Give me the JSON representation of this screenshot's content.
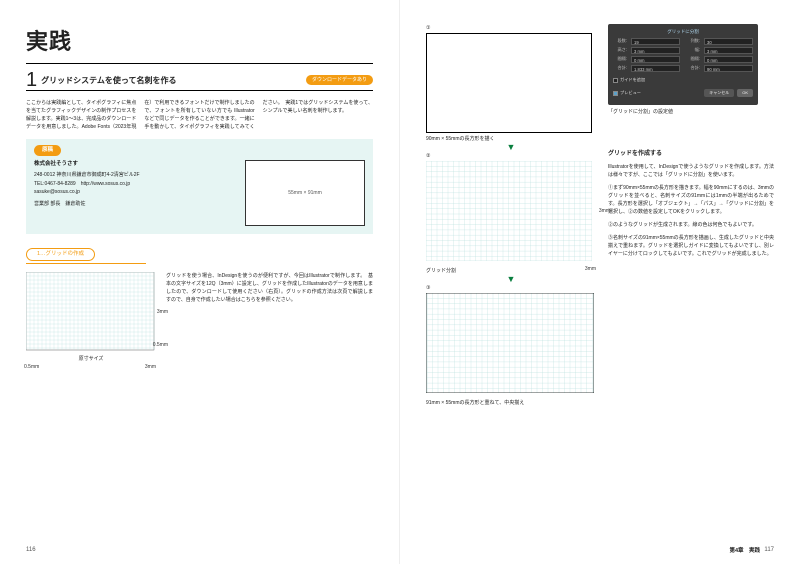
{
  "left": {
    "hero": "実践",
    "section_number": "1",
    "section_title": "グリッドシステムを使って名刺を作る",
    "download_pill": "ダウンロードデータあり",
    "intro": "ここからは実践編として、タイポグラフィに焦点を当てたグラフィックデザインの制作プロセスを解説します。実践1〜3は、完成品のダウンロードデータを用意しました。Adobe Fonts（2023年現在）で利用できるフォントだけで制作しましたので、フォントを所有していない方でも Illustrator などで同じデータを作ることができます。一緒に手を動かして、タイポグラフィを実践してみてください。　実践1ではグリッドシステムを使って、シンプルで美しい名刺を制作します。",
    "card_badge": "原稿",
    "card": {
      "company": "株式会社そうさす",
      "addr": "248-0012 神奈川県鎌倉市御成町4-2清宮ビル2F",
      "tel": "TEL:0467-84-8289　http://www.sosus.co.jp",
      "mail": "sasuke@sosus.co.jp",
      "name": "営業部 部長　鎌倉助佐",
      "size": "55mm × 91mm"
    },
    "sub_pill": "1…グリッドの作成",
    "lower_text": "グリッドを使う場合、InDesignを使うのが便利ですが、今回はIllustratorで制作します。　基本の文字サイズを12Q（3mm）に設定し、グリッドを作成したIllustratorのデータを用意しましたので、ダウンロードして使用ください（右頁）。グリッドの作成方法は次頁で解説しますので、自身で作成したい場合はこちらを参照ください。",
    "fig_caption": "原寸サイズ",
    "dims": {
      "w1": "0.5mm",
      "w2": "3mm",
      "h1": "0.5mm",
      "h2": "3mm"
    }
  },
  "right": {
    "fig1_label": "①",
    "fig1_cap": "90mm × 55mmの長方形を描く",
    "fig2_label": "②",
    "fig2_cap": "グリッド分割",
    "fig2_dim": "3mm",
    "fig3_label": "③",
    "fig3_cap": "91mm × 55mmの長方形と重ねて、中央揃え",
    "dlg_title": "グリッドに分割",
    "dlg_rows_l": [
      "段数:",
      "高さ:",
      "間隔:",
      "合計:"
    ],
    "dlg_rows_r": [
      "列数:",
      "幅:",
      "間隔:",
      "合計:"
    ],
    "dlg_vals_l": [
      "19",
      "3 mm",
      "0 mm",
      "1.833 mm"
    ],
    "dlg_vals_r": [
      "30",
      "3 mm",
      "0 mm",
      "90 mm"
    ],
    "dlg_guide": "ガイドを追加",
    "dlg_preview": "プレビュー",
    "dlg_cancel": "キャンセル",
    "dlg_ok": "OK",
    "dlg_cap": "「グリッドに分割」の設定値",
    "h1": "グリッドを作成する",
    "p1": "Illustratorを使用して、InDesignで使うようなグリッドを作成します。方法は様々ですが、ここでは「グリッドに分割」を使います。",
    "p2": "①まず90mm×55mmの長方形を描きます。幅を90mmにするのは、3mmのグリッドを並べると、名刺サイズの91mmには1mmの半端が出るためです。長方形を選択し「オブジェクト」→「パス」→「グリッドに分割」を選択し、②の数値を設定してOKをクリックします。",
    "p3": "②のようなグリッドが生成されます。線の色は何色でもよいです。",
    "p4": "③名刺サイズの91mm×55mmの長方形を描画し、生成したグリッドと中央揃えで重ねます。グリッドを選択しガイドに変換してもよいですし、別レイヤーに分けてロックしてもよいです。これでグリッドが完成しました。",
    "chapter": "第4章　実践",
    "pagenum_l": "116",
    "pagenum_r": "117"
  }
}
